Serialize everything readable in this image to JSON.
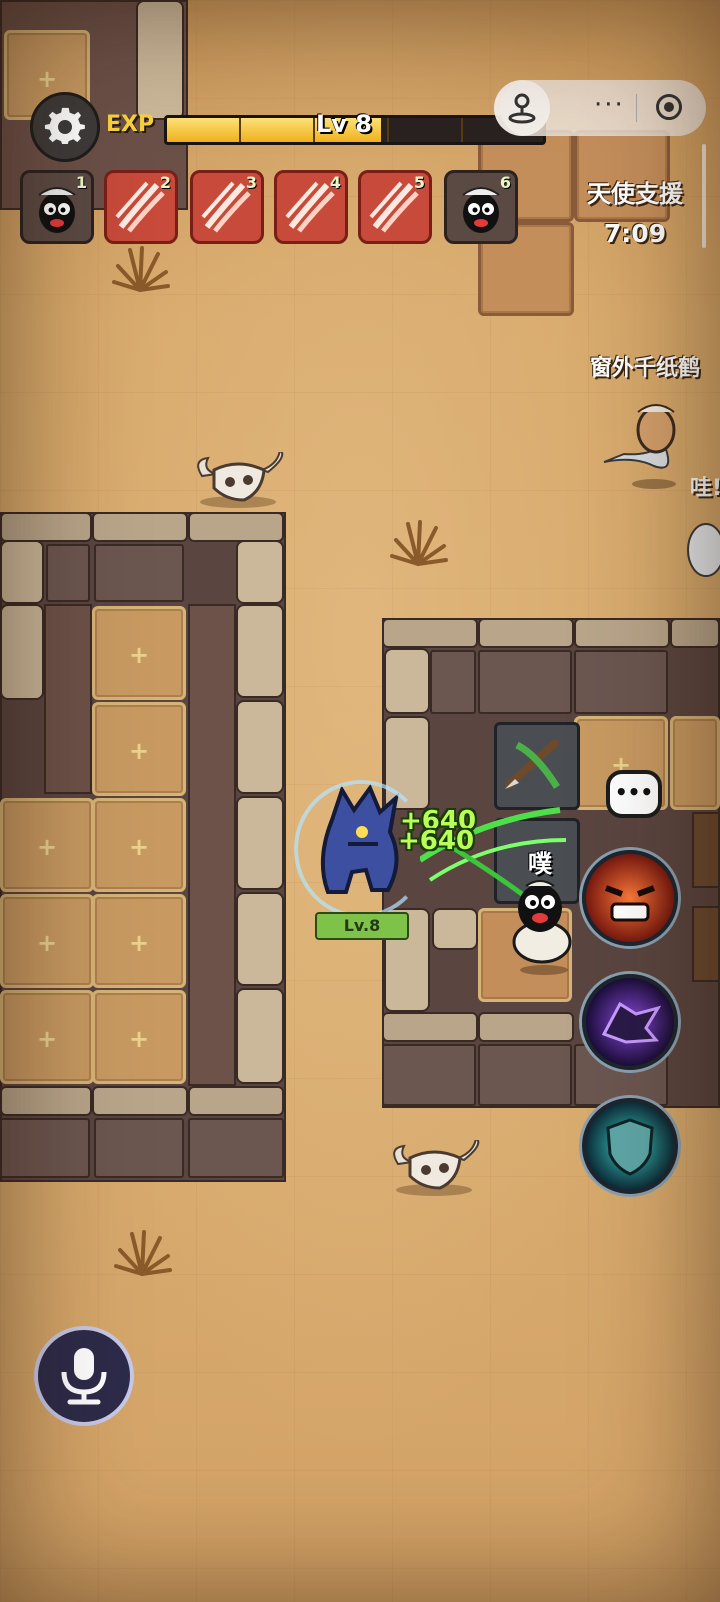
{
  "hud": {
    "exp_label": "EXP",
    "level_label": "Lv 8",
    "exp_progress": 0.57
  },
  "miniprogram": {
    "more_label": "···"
  },
  "slots": [
    {
      "num": "1",
      "icon": "sheep-icon",
      "type": "neutral"
    },
    {
      "num": "2",
      "icon": "claw-icon",
      "type": "red"
    },
    {
      "num": "3",
      "icon": "claw-icon",
      "type": "red"
    },
    {
      "num": "4",
      "icon": "claw-icon",
      "type": "red"
    },
    {
      "num": "5",
      "icon": "claw-icon",
      "type": "red"
    },
    {
      "num": "6",
      "icon": "sheep-icon",
      "type": "neutral"
    }
  ],
  "angel_support": {
    "title": "天使支援",
    "timer": "7:09"
  },
  "players": {
    "name1": "窗外千纸鹤",
    "name2": "哇!"
  },
  "combat": {
    "damage1": "+640",
    "damage2": "+640",
    "werewolf_level": "Lv.8",
    "sheep_shout": "噗"
  },
  "skills": [
    "rage-skill-icon",
    "wolf-skill-icon",
    "shield-skill-icon"
  ],
  "chat_label": "•••",
  "colors": {
    "exp_fill": "#f0b21d",
    "slot_red": "#c74a3a",
    "damage_text": "#b8ff58"
  }
}
